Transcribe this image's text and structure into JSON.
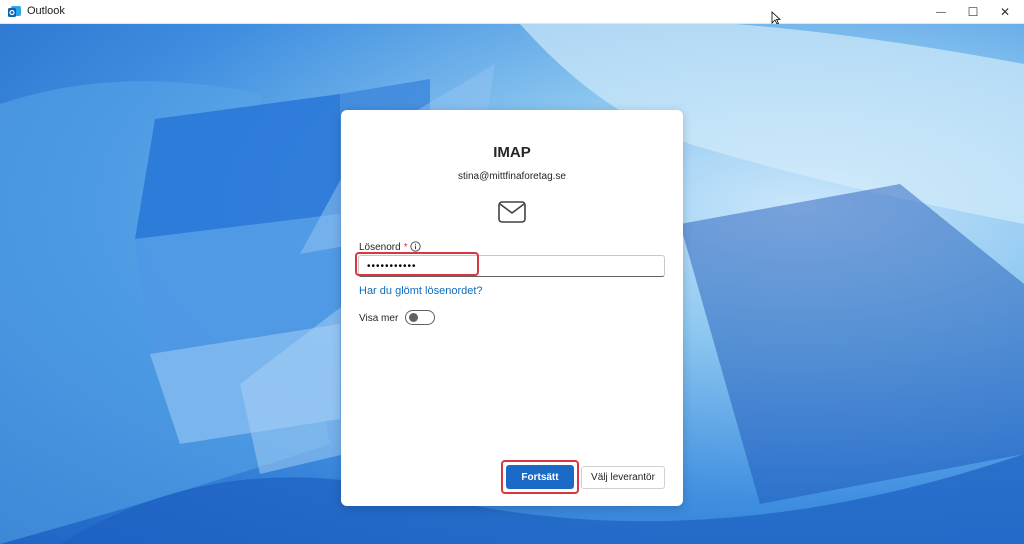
{
  "window": {
    "title": "Outlook",
    "minimize_glyph": "—",
    "maximize_glyph": "☐",
    "close_glyph": "✕"
  },
  "dialog": {
    "title": "IMAP",
    "email": "stina@mittfinaforetag.se",
    "password_label": "Lösenord",
    "required_mark": "*",
    "password_value": "•••••••••••",
    "forgot_link": "Har du glömt lösenordet?",
    "show_more_label": "Visa mer",
    "show_more_on": false,
    "continue_label": "Fortsätt",
    "choose_provider_label": "Välj leverantör"
  },
  "colors": {
    "accent": "#1a6ac6",
    "link": "#0f6cbd",
    "highlight": "#d9363e"
  }
}
